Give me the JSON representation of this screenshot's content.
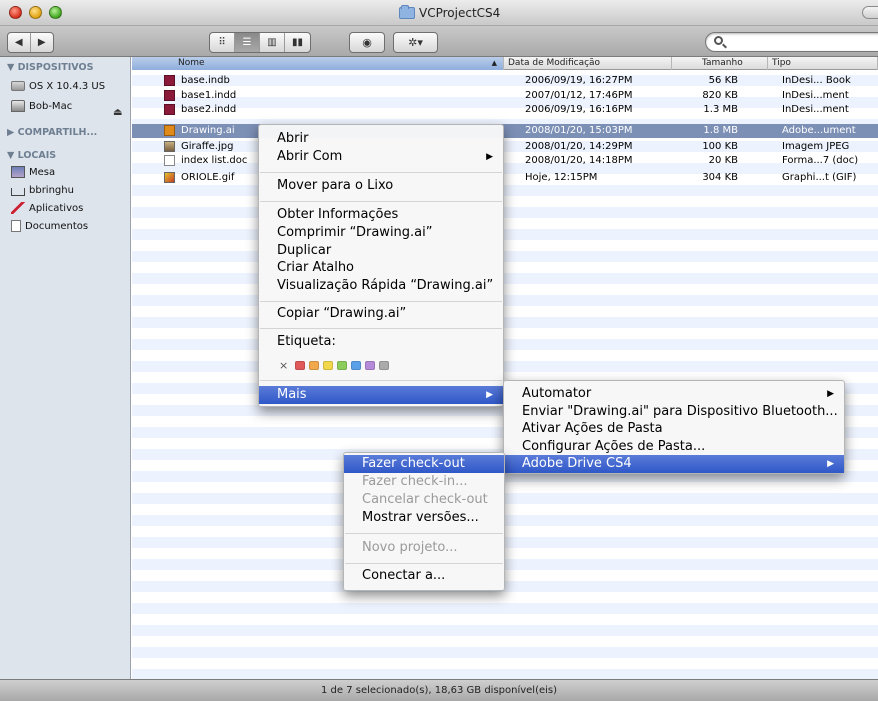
{
  "window": {
    "title": "VCProjectCS4"
  },
  "toolbar": {
    "back_icon": "◀",
    "forward_icon": "▶",
    "view_icons": [
      "⠿",
      "☰",
      "▥",
      "▮▮"
    ],
    "quicklook_icon": "◉",
    "action_icon": "✲▾"
  },
  "sidebar": {
    "sections": [
      {
        "label": "▼ DISPOSITIVOS"
      },
      {
        "label": "▶ COMPARTILH..."
      },
      {
        "label": "▼ LOCAIS"
      }
    ],
    "devices": [
      "OS X 10.4.3 US",
      "Bob-Mac"
    ],
    "places": [
      "Mesa",
      "bbringhu",
      "Aplicativos",
      "Documentos"
    ],
    "eject_icon": "⏏"
  },
  "columns": {
    "name": "Nome",
    "date": "Data de Modificação",
    "size": "Tamanho",
    "kind": "Tipo",
    "sort_icon": "▲"
  },
  "files": [
    {
      "name": "base.indb",
      "date": "2006/09/19, 16:27PM",
      "size": "56 KB",
      "kind": "InDesi... Book"
    },
    {
      "name": "base1.indd",
      "date": "2007/01/12, 17:46PM",
      "size": "820 KB",
      "kind": "InDesi...ment"
    },
    {
      "name": "base2.indd",
      "date": "2006/09/19, 16:16PM",
      "size": "1.3 MB",
      "kind": "InDesi...ment"
    },
    {
      "name": "Drawing.ai",
      "date": "2008/01/20, 15:03PM",
      "size": "1.8 MB",
      "kind": "Adobe...ument"
    },
    {
      "name": "Giraffe.jpg",
      "date": "2008/01/20, 14:29PM",
      "size": "100 KB",
      "kind": "Imagem JPEG"
    },
    {
      "name": "index list.doc",
      "date": "2008/01/20, 14:18PM",
      "size": "20 KB",
      "kind": "Forma...7 (doc)"
    },
    {
      "name": "ORIOLE.gif",
      "date": "Hoje, 12:15PM",
      "size": "304 KB",
      "kind": "Graphi...t (GIF)"
    }
  ],
  "context_menu": {
    "open": "Abrir",
    "open_with": "Abrir Com",
    "move_to_trash": "Mover para o Lixo",
    "get_info": "Obter Informações",
    "compress": "Comprimir “Drawing.ai”",
    "duplicate": "Duplicar",
    "make_alias": "Criar Atalho",
    "quick_look": "Visualização Rápida “Drawing.ai”",
    "copy": "Copiar “Drawing.ai”",
    "label": "Etiqueta:",
    "label_none": "×",
    "label_colors": [
      "#e05a5a",
      "#f0a84a",
      "#f0d84a",
      "#8ccc5a",
      "#5aa0e8",
      "#b58ad8",
      "#aaaaaa"
    ],
    "more": "Mais",
    "submenu_arrow": "▶"
  },
  "more_menu": {
    "automator": "Automator",
    "bluetooth": "Enviar \"Drawing.ai\" para Dispositivo Bluetooth...",
    "enable_folder_actions": "Ativar Ações de Pasta",
    "configure_folder_actions": "Configurar Ações de Pasta...",
    "adobe_drive": "Adobe Drive CS4"
  },
  "adobe_menu": {
    "check_out": "Fazer check-out",
    "check_in": "Fazer check-in...",
    "cancel_check_out": "Cancelar check-out",
    "show_versions": "Mostrar versões...",
    "new_project": "Novo projeto...",
    "connect": "Conectar a..."
  },
  "status": {
    "text": "1 de 7 selecionado(s), 18,63 GB disponível(eis)"
  }
}
